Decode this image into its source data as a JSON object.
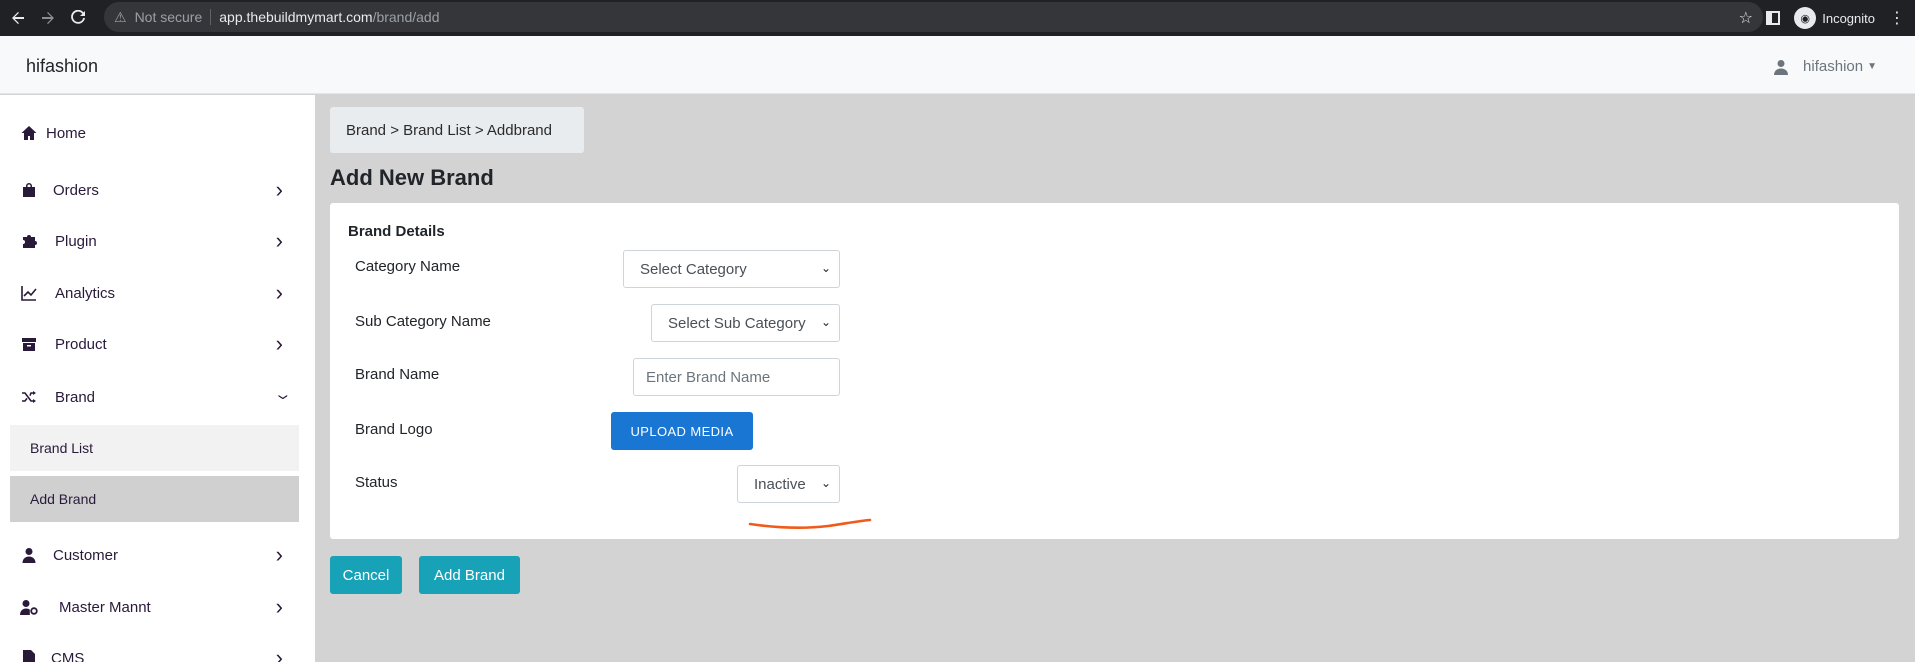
{
  "browser": {
    "security_label": "Not secure",
    "url_host": "app.thebuildmymart.com",
    "url_path": "/brand/add",
    "incognito_label": "Incognito"
  },
  "header": {
    "app_title": "hifashion",
    "user_name": "hifashion"
  },
  "sidebar": {
    "items": [
      {
        "label": "Home",
        "icon": "home-icon"
      },
      {
        "label": "Orders",
        "icon": "shopping-bag-icon"
      },
      {
        "label": "Plugin",
        "icon": "puzzle-icon"
      },
      {
        "label": "Analytics",
        "icon": "chart-line-icon"
      },
      {
        "label": "Product",
        "icon": "archive-box-icon"
      },
      {
        "label": "Brand",
        "icon": "shuffle-icon"
      },
      {
        "label": "Customer",
        "icon": "user-icon"
      },
      {
        "label": "Master Mannt",
        "icon": "user-gear-icon"
      },
      {
        "label": "CMS",
        "icon": "document-icon"
      }
    ],
    "brand_subitems": [
      "Brand List",
      "Add Brand"
    ]
  },
  "breadcrumb": "Brand > Brand List > Addbrand",
  "page_title": "Add New Brand",
  "form": {
    "section_title": "Brand Details",
    "category_label": "Category Name",
    "category_value": "Select Category",
    "subcategory_label": "Sub Category Name",
    "subcategory_value": "Select Sub Category",
    "brand_name_label": "Brand Name",
    "brand_name_placeholder": "Enter Brand Name",
    "brand_logo_label": "Brand Logo",
    "upload_label": "UPLOAD MEDIA",
    "status_label": "Status",
    "status_value": "Inactive"
  },
  "actions": {
    "cancel_label": "Cancel",
    "add_label": "Add Brand"
  },
  "colors": {
    "primary_button": "#1976d2",
    "teal_button": "#17a2b8",
    "annotation": "#f05a1a"
  }
}
